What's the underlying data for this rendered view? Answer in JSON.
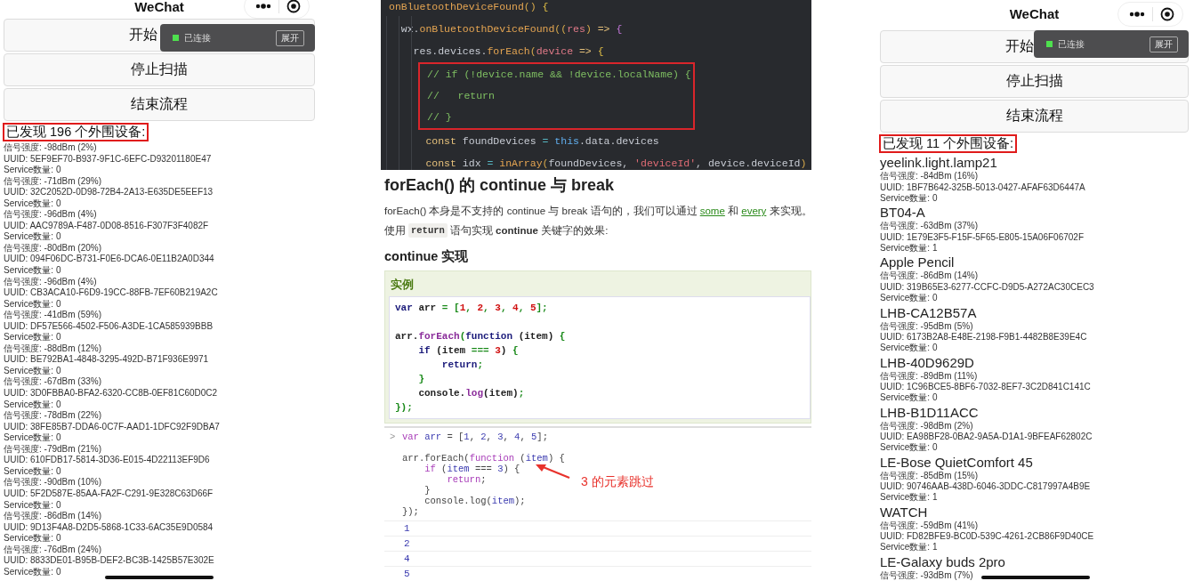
{
  "left_phone": {
    "title": "WeChat",
    "buttons": [
      "开始",
      "停止扫描",
      "结束流程"
    ],
    "status_popup": {
      "status": "已连接",
      "connected": true,
      "button": "展开"
    },
    "found_heading": "已发现 196 个外围设备:",
    "devices": [
      {
        "signal": "信号强度: -98dBm (2%)",
        "uuid": "UUID: 5EF9EF70-B937-9F1C-6EFC-D93201180E47",
        "services": "Service数量: 0"
      },
      {
        "signal": "信号强度: -71dBm (29%)",
        "uuid": "UUID: 32C2052D-0D98-72B4-2A13-E635DE5EEF13",
        "services": "Service数量: 0"
      },
      {
        "signal": "信号强度: -96dBm (4%)",
        "uuid": "UUID: AAC9789A-F487-0D08-8516-F307F3F4082F",
        "services": "Service数量: 0"
      },
      {
        "signal": "信号强度: -80dBm (20%)",
        "uuid": "UUID: 094F06DC-B731-F0E6-DCA6-0E11B2A0D344",
        "services": "Service数量: 0"
      },
      {
        "signal": "信号强度: -96dBm (4%)",
        "uuid": "UUID: CB3ACA10-F6D9-19CC-88FB-7EF60B219A2C",
        "services": "Service数量: 0"
      },
      {
        "signal": "信号强度: -41dBm (59%)",
        "uuid": "UUID: DF57E566-4502-F506-A3DE-1CA585939BBB",
        "services": "Service数量: 0"
      },
      {
        "signal": "信号强度: -88dBm (12%)",
        "uuid": "UUID: BE792BA1-4848-3295-492D-B71F936E9971",
        "services": "Service数量: 0"
      },
      {
        "signal": "信号强度: -67dBm (33%)",
        "uuid": "UUID: 3D0FBBA0-BFA2-6320-CC8B-0EF81C60D0C2",
        "services": "Service数量: 0"
      },
      {
        "signal": "信号强度: -78dBm (22%)",
        "uuid": "UUID: 38FE85B7-DDA6-0C7F-AAD1-1DFC92F9DBA7",
        "services": "Service数量: 0"
      },
      {
        "signal": "信号强度: -79dBm (21%)",
        "uuid": "UUID: 610FDB17-5814-3D36-E015-4D22113EF9D6",
        "services": "Service数量: 0"
      },
      {
        "signal": "信号强度: -90dBm (10%)",
        "uuid": "UUID: 5F2D587E-85AA-FA2F-C291-9E328C63D66F",
        "services": "Service数量: 0"
      },
      {
        "signal": "信号强度: -86dBm (14%)",
        "uuid": "UUID: 9D13F4A8-D2D5-5868-1C33-6AC35E9D0584",
        "services": "Service数量: 0"
      },
      {
        "signal": "信号强度: -76dBm (24%)",
        "uuid": "UUID: 8833DE01-B95B-DEF2-BC3B-1425B57E302E",
        "services": "Service数量: 0"
      }
    ]
  },
  "code_article": {
    "editor_lines": [
      {
        "boxed": false,
        "tokens": [
          {
            "text": "onBluetoothDeviceFound",
            "kind": "fn"
          },
          {
            "text": "() ",
            "kind": "paren"
          },
          {
            "text": "{",
            "kind": "brace"
          }
        ]
      },
      {
        "boxed": false,
        "tokens": [
          {
            "text": "  wx.",
            "kind": "plain"
          },
          {
            "text": "onBluetoothDeviceFound",
            "kind": "fn"
          },
          {
            "text": "((",
            "kind": "paren"
          },
          {
            "text": "res",
            "kind": "param"
          },
          {
            "text": ") ",
            "kind": "paren"
          },
          {
            "text": "=>",
            "kind": "arrow"
          },
          {
            "text": " {",
            "kind": "brace2"
          }
        ]
      },
      {
        "boxed": false,
        "tokens": [
          {
            "text": "    res.devices.",
            "kind": "plain"
          },
          {
            "text": "forEach",
            "kind": "fn"
          },
          {
            "text": "(",
            "kind": "paren"
          },
          {
            "text": "device",
            "kind": "param"
          },
          {
            "text": " => ",
            "kind": "arrow"
          },
          {
            "text": "{",
            "kind": "brace"
          }
        ]
      },
      {
        "boxed": true,
        "tokens": [
          {
            "text": "// if (!device.name && !device.localName) {",
            "kind": "comment"
          }
        ]
      },
      {
        "boxed": true,
        "tokens": [
          {
            "text": "//   return",
            "kind": "comment"
          }
        ]
      },
      {
        "boxed": true,
        "tokens": [
          {
            "text": "// }",
            "kind": "comment"
          }
        ]
      },
      {
        "boxed": false,
        "tokens": [
          {
            "text": "      const",
            "kind": "kw"
          },
          {
            "text": " foundDevices ",
            "kind": "plain"
          },
          {
            "text": "=",
            "kind": "op"
          },
          {
            "text": " this",
            "kind": "this"
          },
          {
            "text": ".data.devices",
            "kind": "plain"
          }
        ]
      },
      {
        "boxed": false,
        "tokens": [
          {
            "text": "      const",
            "kind": "kw"
          },
          {
            "text": " idx ",
            "kind": "plain"
          },
          {
            "text": "=",
            "kind": "op"
          },
          {
            "text": " inArray",
            "kind": "fn"
          },
          {
            "text": "(",
            "kind": "paren"
          },
          {
            "text": "foundDevices, ",
            "kind": "plain"
          },
          {
            "text": "'deviceId'",
            "kind": "str"
          },
          {
            "text": ", device.deviceId",
            "kind": "plain"
          },
          {
            "text": ")",
            "kind": "paren"
          }
        ]
      }
    ],
    "heading": "forEach() 的 continue 与 break",
    "intro": {
      "before": "forEach() 本身是不支持的 continue 与 break 语句的，我们可以通过 ",
      "link1": "some",
      "middle": " 和 ",
      "link2": "every",
      "after": " 来实现。"
    },
    "usage": {
      "before": "使用",
      "code": "return",
      "after": "语句实现 **continue** 关键字的效果:"
    },
    "subheading": "continue 实现",
    "example": {
      "title": "实例",
      "blocks": [
        [
          {
            "tokens": [
              {
                "text": "var",
                "kind": "x-kw"
              },
              {
                "text": " arr ",
                "kind": "x-plain"
              },
              {
                "text": "=",
                "kind": "x-op"
              },
              {
                "text": " [",
                "kind": "x-punc"
              },
              {
                "text": "1",
                "kind": "x-num"
              },
              {
                "text": ", ",
                "kind": "x-punc"
              },
              {
                "text": "2",
                "kind": "x-num"
              },
              {
                "text": ", ",
                "kind": "x-punc"
              },
              {
                "text": "3",
                "kind": "x-num"
              },
              {
                "text": ", ",
                "kind": "x-punc"
              },
              {
                "text": "4",
                "kind": "x-num"
              },
              {
                "text": ", ",
                "kind": "x-punc"
              },
              {
                "text": "5",
                "kind": "x-num"
              },
              {
                "text": "];",
                "kind": "x-punc"
              }
            ]
          }
        ],
        [
          {
            "tokens": [
              {
                "text": "arr.",
                "kind": "x-plain"
              },
              {
                "text": "forEach",
                "kind": "x-fn"
              },
              {
                "text": "(",
                "kind": "x-punc"
              },
              {
                "text": "function",
                "kind": "x-kw"
              },
              {
                "text": " (item) ",
                "kind": "x-plain"
              },
              {
                "text": "{",
                "kind": "x-punc"
              }
            ]
          },
          {
            "tokens": [
              {
                "text": "    if",
                "kind": "x-kw"
              },
              {
                "text": " (item ",
                "kind": "x-plain"
              },
              {
                "text": "===",
                "kind": "x-op"
              },
              {
                "text": " 3",
                "kind": "x-num"
              },
              {
                "text": ") ",
                "kind": "x-plain"
              },
              {
                "text": "{",
                "kind": "x-punc"
              }
            ]
          },
          {
            "tokens": [
              {
                "text": "        return",
                "kind": "x-kw"
              },
              {
                "text": ";",
                "kind": "x-punc"
              }
            ]
          },
          {
            "tokens": [
              {
                "text": "    }",
                "kind": "x-punc"
              }
            ]
          },
          {
            "tokens": [
              {
                "text": "    console.",
                "kind": "x-plain"
              },
              {
                "text": "log",
                "kind": "x-fn"
              },
              {
                "text": "(item)",
                "kind": "x-plain"
              },
              {
                "text": ";",
                "kind": "x-punc"
              }
            ]
          },
          {
            "tokens": [
              {
                "text": "});",
                "kind": "x-punc"
              }
            ]
          }
        ]
      ]
    },
    "console": {
      "prompt": ">",
      "blocks": [
        [
          {
            "tokens": [
              {
                "text": "var",
                "kind": "c-kw"
              },
              {
                "text": " arr ",
                "kind": "c-var"
              },
              {
                "text": "=",
                "kind": "c-plain"
              },
              {
                "text": " [",
                "kind": "c-plain"
              },
              {
                "text": "1",
                "kind": "c-num"
              },
              {
                "text": ", ",
                "kind": "c-plain"
              },
              {
                "text": "2",
                "kind": "c-num"
              },
              {
                "text": ", ",
                "kind": "c-plain"
              },
              {
                "text": "3",
                "kind": "c-num"
              },
              {
                "text": ", ",
                "kind": "c-plain"
              },
              {
                "text": "4",
                "kind": "c-num"
              },
              {
                "text": ", ",
                "kind": "c-plain"
              },
              {
                "text": "5",
                "kind": "c-num"
              },
              {
                "text": "];",
                "kind": "c-plain"
              }
            ]
          }
        ],
        [
          {
            "tokens": [
              {
                "text": "arr.forEach(",
                "kind": "c-plain"
              },
              {
                "text": "function",
                "kind": "c-kw"
              },
              {
                "text": " (",
                "kind": "c-plain"
              },
              {
                "text": "item",
                "kind": "c-var"
              },
              {
                "text": ") {",
                "kind": "c-plain"
              }
            ]
          },
          {
            "tokens": [
              {
                "text": "    if",
                "kind": "c-kw"
              },
              {
                "text": " (",
                "kind": "c-plain"
              },
              {
                "text": "item",
                "kind": "c-var"
              },
              {
                "text": " === ",
                "kind": "c-plain"
              },
              {
                "text": "3",
                "kind": "c-num"
              },
              {
                "text": ") {",
                "kind": "c-plain"
              }
            ]
          },
          {
            "tokens": [
              {
                "text": "        return",
                "kind": "c-kw"
              },
              {
                "text": ";",
                "kind": "c-plain"
              }
            ]
          },
          {
            "tokens": [
              {
                "text": "    }",
                "kind": "c-plain"
              }
            ]
          },
          {
            "tokens": [
              {
                "text": "    console.log(",
                "kind": "c-plain"
              },
              {
                "text": "item",
                "kind": "c-var"
              },
              {
                "text": ");",
                "kind": "c-plain"
              }
            ]
          },
          {
            "tokens": [
              {
                "text": "});",
                "kind": "c-plain"
              }
            ]
          }
        ]
      ],
      "annotation": "3 的元素跳过",
      "outputs": [
        "1",
        "2",
        "4",
        "5"
      ]
    }
  },
  "right_phone": {
    "title": "WeChat",
    "buttons": [
      "开始",
      "停止扫描",
      "结束流程"
    ],
    "status_popup": {
      "status": "已连接",
      "connected": true,
      "button": "展开"
    },
    "found_heading": "已发现 11 个外围设备:",
    "devices": [
      {
        "name": "yeelink.light.lamp21",
        "signal": "信号强度: -84dBm (16%)",
        "uuid": "UUID: 1BF7B642-325B-5013-0427-AFAF63D6447A",
        "services": "Service数量: 0"
      },
      {
        "name": "BT04-A",
        "signal": "信号强度: -63dBm (37%)",
        "uuid": "UUID: 1E79E3F5-F15F-5F65-E805-15A06F06702F",
        "services": "Service数量: 1"
      },
      {
        "name": "Apple Pencil",
        "signal": "信号强度: -86dBm (14%)",
        "uuid": "UUID: 319B65E3-6277-CCFC-D9D5-A272AC30CEC3",
        "services": "Service数量: 0"
      },
      {
        "name": "LHB-CA12B57A",
        "signal": "信号强度: -95dBm (5%)",
        "uuid": "UUID: 6173B2A8-E48E-2198-F9B1-4482B8E39E4C",
        "services": "Service数量: 0"
      },
      {
        "name": "LHB-40D9629D",
        "signal": "信号强度: -89dBm (11%)",
        "uuid": "UUID: 1C96BCE5-8BF6-7032-8EF7-3C2D841C141C",
        "services": "Service数量: 0"
      },
      {
        "name": "LHB-B1D11ACC",
        "signal": "信号强度: -98dBm (2%)",
        "uuid": "UUID: EA98BF28-0BA2-9A5A-D1A1-9BFEAF62802C",
        "services": "Service数量: 0"
      },
      {
        "name": "LE-Bose QuietComfort 45",
        "signal": "信号强度: -85dBm (15%)",
        "uuid": "UUID: 90746AAB-438D-6046-3DDC-C817997A4B9E",
        "services": "Service数量: 1"
      },
      {
        "name": "WATCH",
        "signal": "信号强度: -59dBm (41%)",
        "uuid": "UUID: FD82BFE9-BC0D-539C-4261-2CB86F9D40CE",
        "services": "Service数量: 1"
      },
      {
        "name": "LE-Galaxy buds 2pro",
        "signal": "信号强度: -93dBm (7%)"
      }
    ]
  }
}
